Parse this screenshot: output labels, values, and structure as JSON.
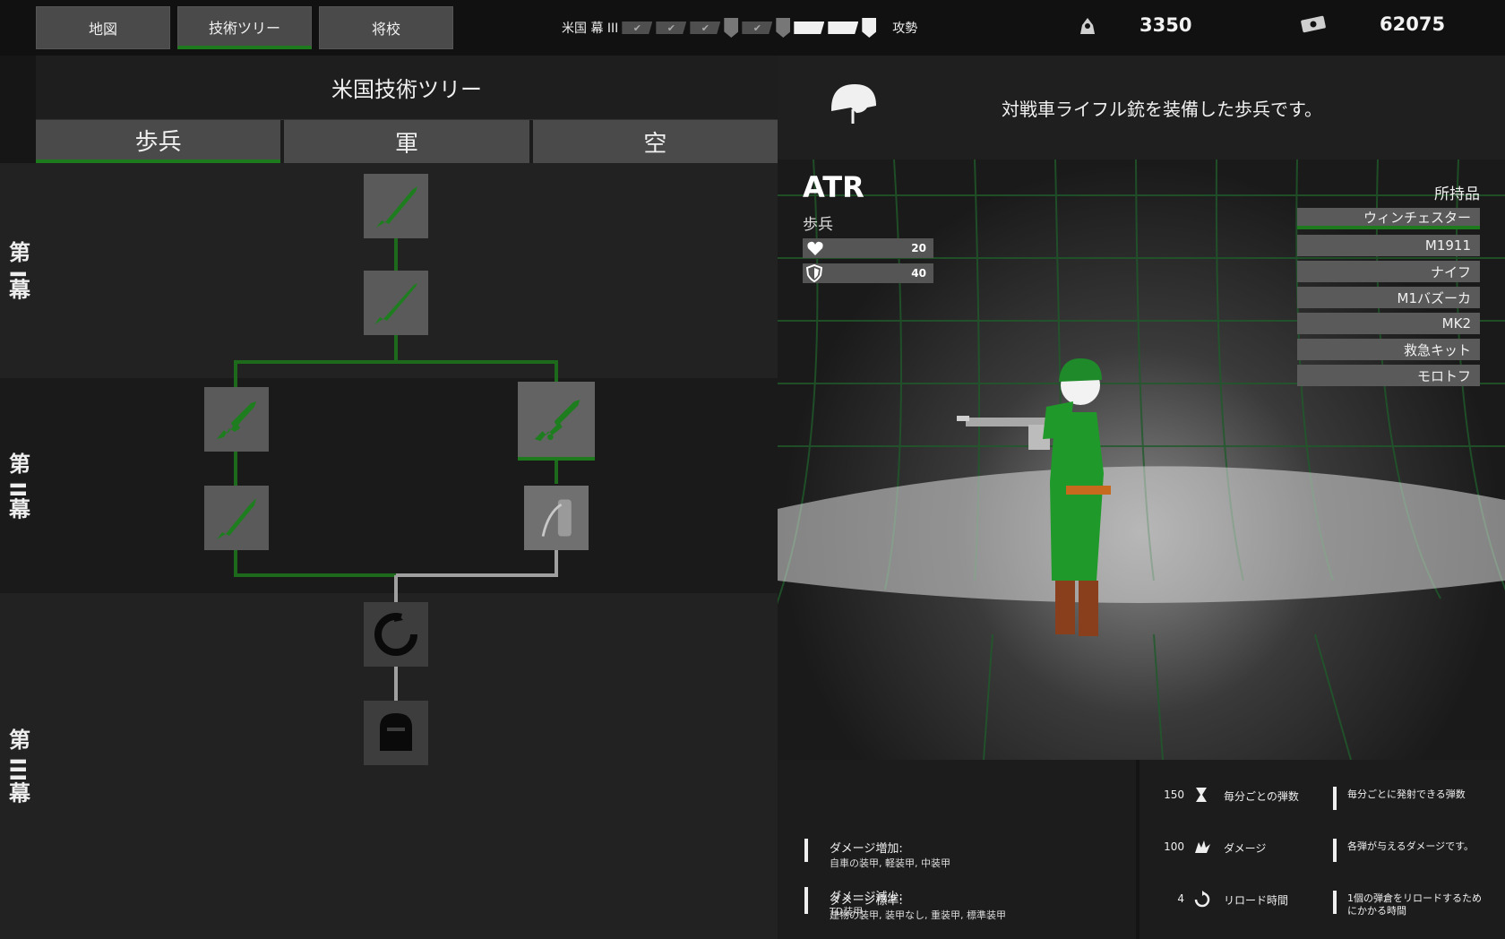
{
  "topbar": {
    "buttons": [
      "地図",
      "技術ツリー",
      "将校"
    ],
    "campaign_label": "米国 幕 III",
    "campaign_end_label": "攻勢",
    "resource1": "3350",
    "resource2": "62075"
  },
  "tree": {
    "title": "米国技術ツリー",
    "tabs": [
      "歩兵",
      "軍",
      "空"
    ],
    "rows": [
      "第 I幕",
      "第 II幕",
      "第 III幕"
    ]
  },
  "unit": {
    "description": "対戦車ライフル銃を装備した歩兵です。",
    "name": "ATR",
    "type": "歩兵",
    "health": "20",
    "armor": "40"
  },
  "inventory": {
    "title": "所持品",
    "items": [
      "ウィンチェスター",
      "M1911",
      "ナイフ",
      "M1バズーカ",
      "MK2",
      "救急キット",
      "モロトフ"
    ]
  },
  "damage": [
    {
      "title": "ダメージ増加:",
      "sub": "自車の装甲, 軽装甲, 中装甲"
    },
    {
      "title": "ダメージ標準:",
      "sub": "建物の装甲, 装甲なし, 重装甲, 標準装甲"
    },
    {
      "title": "ダメージ減少:",
      "sub": "TD装甲"
    }
  ],
  "stats": [
    {
      "value": "150",
      "label": "毎分ごとの弾数",
      "explain": "毎分ごとに発射できる弾数"
    },
    {
      "value": "100",
      "label": "ダメージ",
      "explain": "各弾が与えるダメージです。"
    },
    {
      "value": "4",
      "label": "リロード時間",
      "explain": "1個の弾倉をリロードするためにかかる時間"
    }
  ],
  "colors": {
    "accent": "#1d7a1d",
    "node": "#5a5a5a",
    "panel": "#1c1c1c"
  }
}
